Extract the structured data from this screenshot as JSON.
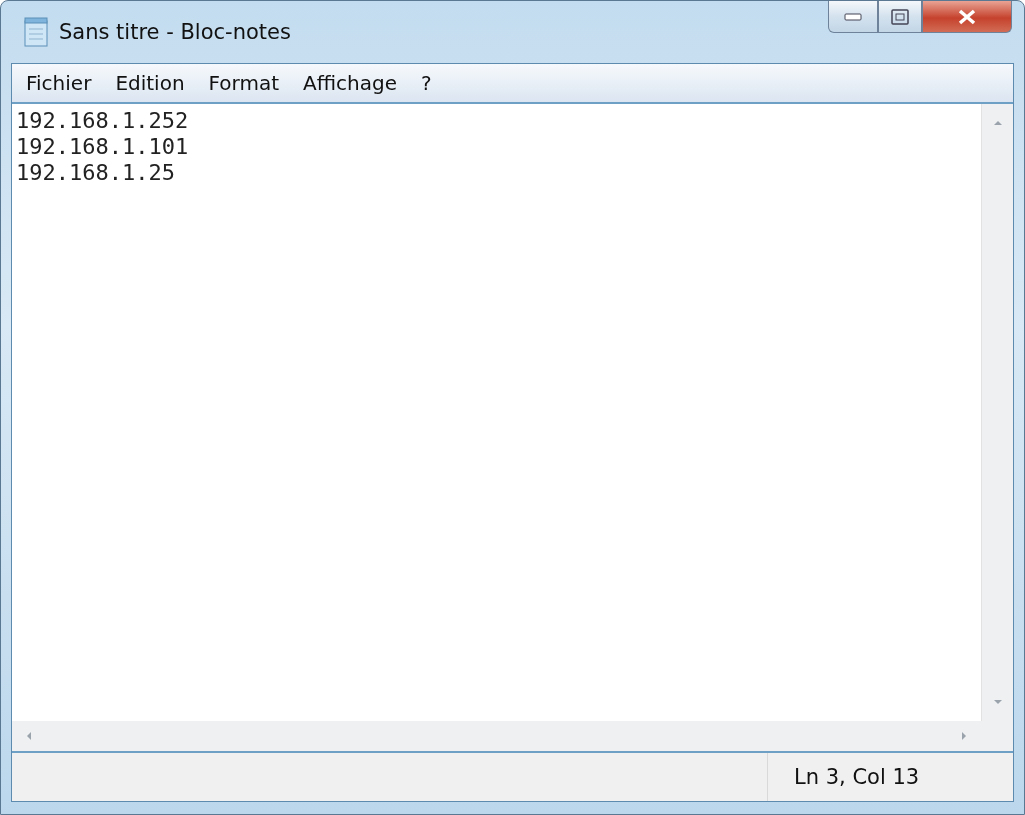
{
  "window": {
    "title": "Sans titre - Bloc-notes"
  },
  "menu": [
    "Fichier",
    "Edition",
    "Format",
    "Affichage",
    "?"
  ],
  "editor": {
    "lines": [
      "192.168.1.252",
      "192.168.1.101",
      "192.168.1.25"
    ]
  },
  "status_bar": {
    "position": "Ln 3, Col 13"
  }
}
